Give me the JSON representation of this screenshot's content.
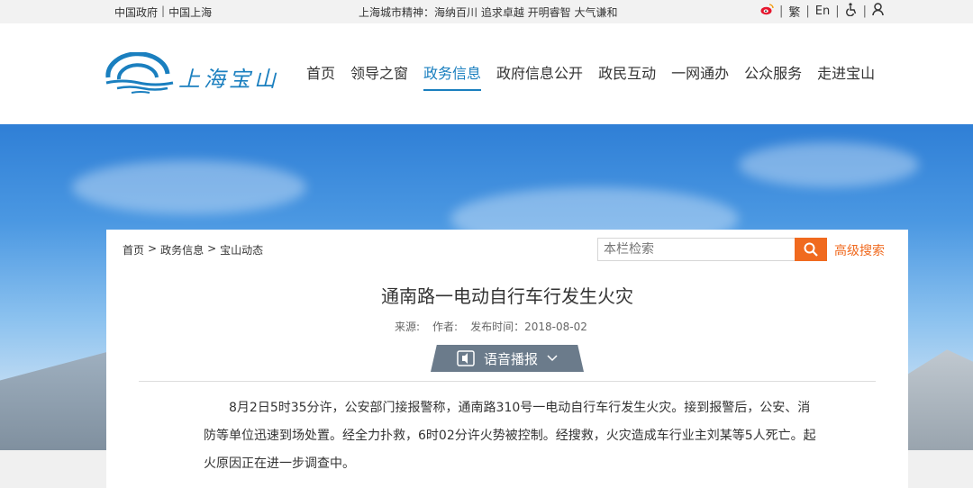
{
  "topbar": {
    "gov_links": [
      "中国政府",
      "中国上海"
    ],
    "slogan": "上海城市精神：海纳百川 追求卓越 开明睿智 大气谦和",
    "traditional": "繁",
    "english": "En"
  },
  "logo": {
    "text": "上海宝山"
  },
  "nav": {
    "items": [
      "首页",
      "领导之窗",
      "政务信息",
      "政府信息公开",
      "政民互动",
      "一网通办",
      "公众服务",
      "走进宝山"
    ],
    "active_index": 2
  },
  "breadcrumb": [
    "首页",
    "政务信息",
    "宝山动态"
  ],
  "search": {
    "placeholder": "本栏检索",
    "advanced_label": "高级搜索"
  },
  "article": {
    "title": "通南路一电动自行车行发生火灾",
    "source_label": "来源:",
    "author_label": "作者:",
    "date_label": "发布时间：2018-08-02",
    "voice_label": "语音播报",
    "body": "8月2日5时35分许，公安部门接报警称，通南路310号一电动自行车行发生火灾。接到报警后，公安、消防等单位迅速到场处置。经全力扑救，6时02分许火势被控制。经搜救，火灾造成车行业主刘某等5人死亡。起火原因正在进一步调查中。"
  },
  "colors": {
    "brand": "#1a7fbf",
    "accent": "#f06a1f"
  }
}
